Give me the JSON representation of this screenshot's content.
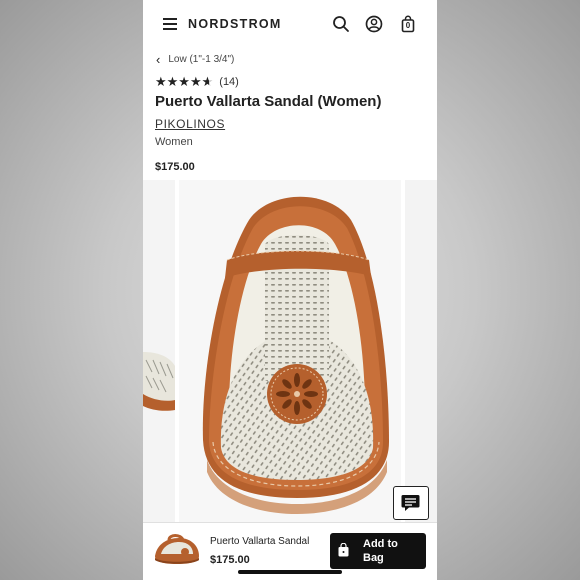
{
  "header": {
    "brand": "NORDSTROM",
    "menu_icon": "menu-icon",
    "search_icon": "search-icon",
    "account_icon": "account-icon",
    "bag_icon": "shopping-bag-icon",
    "bag_count": "0"
  },
  "breadcrumb": {
    "label": "Low (1\"-1 3/4\")"
  },
  "product": {
    "rating": 4.5,
    "rating_max": 5,
    "review_count": "(14)",
    "title": "Puerto Vallarta Sandal (Women)",
    "brand": "PIKOLINOS",
    "gender": "Women",
    "price": "$175.00"
  },
  "gallery": {
    "colors": {
      "leather": "#b5602d",
      "leather_dark": "#8a441c",
      "cream": "#e8e6dc",
      "sole": "#d4a07a"
    }
  },
  "chat": {
    "icon": "chat-icon"
  },
  "bottom_bar": {
    "product_name": "Puerto Vallarta Sandal",
    "price": "$175.00",
    "add_to_bag_line1": "Add to",
    "add_to_bag_line2": "Bag",
    "bag_icon": "shopping-bag-icon"
  }
}
